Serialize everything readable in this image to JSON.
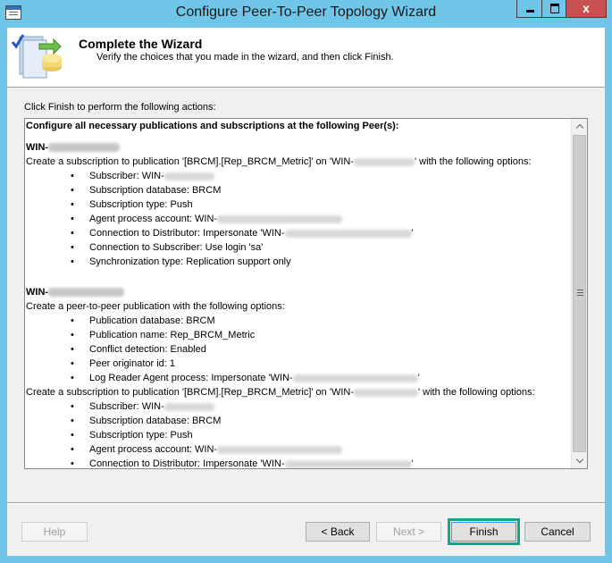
{
  "window": {
    "title": "Configure Peer-To-Peer Topology Wizard",
    "close_glyph": "x",
    "colors": {
      "title_bar": "#6fc6e8",
      "close_button": "#c75050",
      "highlight": "#17a585"
    }
  },
  "header": {
    "title": "Complete the Wizard",
    "subtitle": "Verify the choices that you made in the wizard, and then click Finish."
  },
  "instruction": "Click Finish to perform the following actions:",
  "summary": {
    "heading": "Configure all necessary publications and subscriptions at the following Peer(s):",
    "peer1": {
      "name": "WIN-",
      "subscription_line_a": "Create a subscription to publication '[BRCM].[Rep_BRCM_Metric]' on 'WIN-",
      "subscription_line_b": "' with the following options:",
      "options": {
        "subscriber": "Subscriber: WIN-",
        "subscription_db": "Subscription database: BRCM",
        "subscription_type": "Subscription type: Push",
        "agent_account": "Agent process account: WIN-",
        "conn_distributor_a": "Connection to Distributor: Impersonate 'WIN-",
        "conn_distributor_b": "'",
        "conn_subscriber": "Connection to Subscriber: Use login 'sa'",
        "sync_type": "Synchronization type: Replication support only"
      }
    },
    "peer2": {
      "name": "WIN-",
      "p2p_line": "Create a peer-to-peer publication with the following options:",
      "publication_options": {
        "pub_db": "Publication database: BRCM",
        "pub_name": "Publication name: Rep_BRCM_Metric",
        "conflict": "Conflict detection: Enabled",
        "originator": "Peer originator id: 1",
        "log_reader_a": "Log Reader Agent process: Impersonate 'WIN-",
        "log_reader_b": "'"
      },
      "subscription_line_a": "Create a subscription to publication '[BRCM].[Rep_BRCM_Metric]' on 'WIN-",
      "subscription_line_b": "' with the following options:",
      "subscription_options": {
        "subscriber": "Subscriber: WIN-",
        "subscription_db": "Subscription database: BRCM",
        "subscription_type": "Subscription type: Push",
        "agent_account": "Agent process account: WIN-",
        "conn_distributor_a": "Connection to Distributor: Impersonate 'WIN-",
        "conn_distributor_b": "'"
      }
    }
  },
  "buttons": {
    "help": "Help",
    "back": "< Back",
    "next": "Next >",
    "finish": "Finish",
    "cancel": "Cancel"
  }
}
